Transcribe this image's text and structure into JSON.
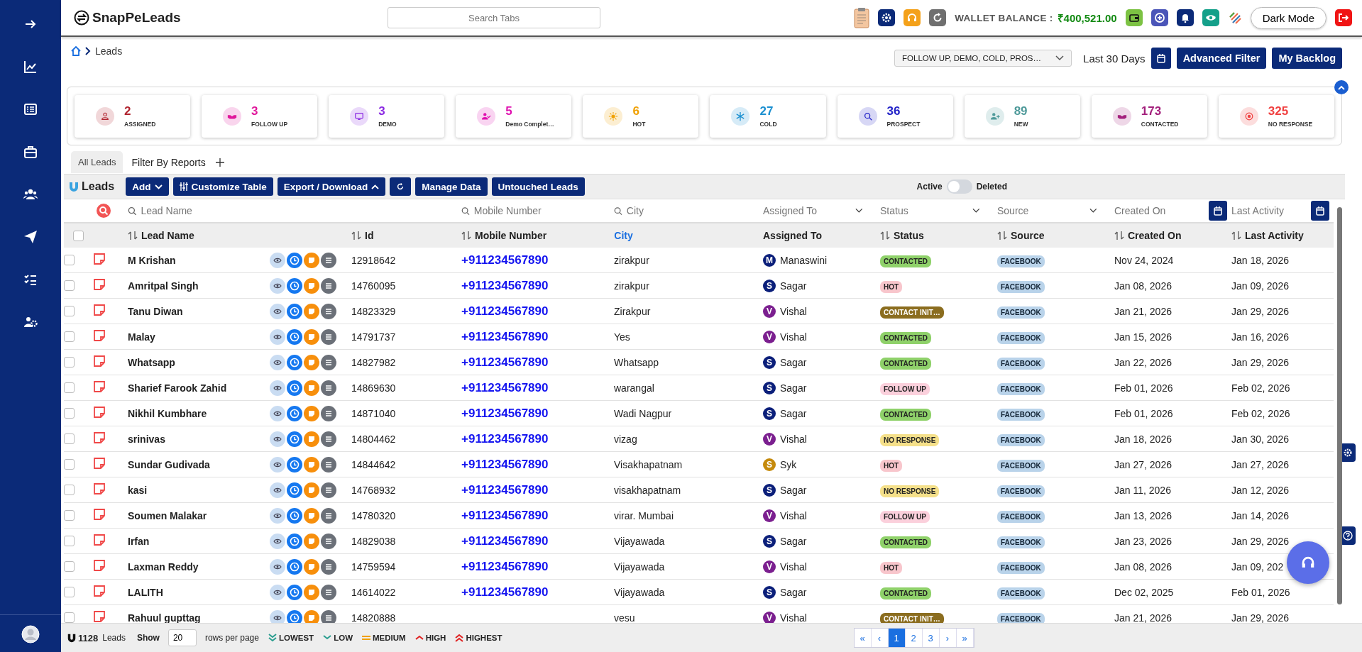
{
  "app": {
    "logo": "SnapPeLeads",
    "search": {
      "placeholder": "Search Tabs"
    },
    "wallet": {
      "label": "WALLET BALANCE :",
      "value": "₹400,521.00"
    },
    "dark_mode_button": "Dark Mode"
  },
  "breadcrumb": [
    "Leads"
  ],
  "filters": {
    "status_select": "FOLLOW UP, DEMO, COLD, PROS…",
    "range": "Last 30 Days",
    "buttons": [
      "Advanced Filter",
      "My Backlog"
    ]
  },
  "stats": [
    {
      "value": "2",
      "label": "ASSIGNED",
      "color": "#b0232e"
    },
    {
      "value": "3",
      "label": "FOLLOW UP",
      "color": "#e0179b"
    },
    {
      "value": "3",
      "label": "DEMO",
      "color": "#8b2be2"
    },
    {
      "value": "5",
      "label": "Demo Complet…",
      "color": "#e010b0"
    },
    {
      "value": "6",
      "label": "HOT",
      "color": "#f0a000"
    },
    {
      "value": "27",
      "label": "COLD",
      "color": "#1a8fd0"
    },
    {
      "value": "36",
      "label": "PROSPECT",
      "color": "#2222c8"
    },
    {
      "value": "89",
      "label": "NEW",
      "color": "#4f9a9a"
    },
    {
      "value": "173",
      "label": "CONTACTED",
      "color": "#a3207c"
    },
    {
      "value": "325",
      "label": "NO RESPONSE",
      "color": "#f04040"
    }
  ],
  "tabs": [
    {
      "label": "All Leads",
      "selected": true
    },
    {
      "label": "Filter By Reports",
      "selected": false
    }
  ],
  "toolbar": {
    "title": "Leads",
    "buttons": [
      {
        "label": "Add",
        "kind": "caret-down"
      },
      {
        "label": "Customize Table",
        "kind": "sliders"
      },
      {
        "label": "Export / Download",
        "kind": "caret-up"
      },
      {
        "kind": "refresh"
      },
      {
        "label": "Manage Data",
        "kind": "plain"
      },
      {
        "label": "Untouched Leads",
        "kind": "plain"
      }
    ],
    "toggle": {
      "left": "Active",
      "right": "Deleted",
      "on": false
    }
  },
  "column_filters": [
    {
      "kind": "search",
      "placeholder": "Lead Name"
    },
    {
      "kind": "search",
      "placeholder": "Mobile Number"
    },
    {
      "kind": "search",
      "placeholder": "City"
    },
    {
      "kind": "select",
      "placeholder": "Assigned To"
    },
    {
      "kind": "select",
      "placeholder": "Status"
    },
    {
      "kind": "select",
      "placeholder": "Source"
    },
    {
      "kind": "date",
      "placeholder": "Created On"
    },
    {
      "kind": "date",
      "placeholder": "Last Activity"
    }
  ],
  "select_all": {
    "checked": false
  },
  "columns": [
    {
      "label": "Lead Name",
      "kind": "sortable"
    },
    {
      "label": "Id",
      "kind": "sortable"
    },
    {
      "label": "Mobile Number",
      "kind": "sortable"
    },
    {
      "label": "City",
      "kind": "sorted"
    },
    {
      "label": "Assigned To",
      "kind": "plain"
    },
    {
      "label": "Status",
      "kind": "sortable"
    },
    {
      "label": "Source",
      "kind": "sortable"
    },
    {
      "label": "Created On",
      "kind": "sortable"
    },
    {
      "label": "Last Activity",
      "kind": "sortable"
    }
  ],
  "rows": [
    {
      "name": "M Krishan",
      "id": "12918642",
      "mobile": "+911234567890",
      "city": "zirakpur",
      "avatar": {
        "initial": "M",
        "color": "#0b1f7a"
      },
      "assigned": "Manaswini",
      "status": {
        "label": "CONTACTED",
        "color": "#8fd16a"
      },
      "source": "FACEBOOK",
      "created": "Nov 24, 2024",
      "last": "Jan 18, 2026",
      "checked": false
    },
    {
      "name": "Amritpal Singh",
      "id": "14760095",
      "mobile": "+911234567890",
      "city": "zirakpur",
      "avatar": {
        "initial": "S",
        "color": "#0b1f7a"
      },
      "assigned": "Sagar",
      "status": {
        "label": "HOT",
        "color": "#f8c6cc"
      },
      "source": "FACEBOOK",
      "created": "Jan 08, 2026",
      "last": "Jan 09, 2026",
      "checked": false
    },
    {
      "name": "Tanu Diwan",
      "id": "14823329",
      "mobile": "+911234567890",
      "city": "Zirakpur",
      "avatar": {
        "initial": "V",
        "color": "#7b1f8f"
      },
      "assigned": "Vishal",
      "status": {
        "label": "CONTACT INIT…",
        "color": "#8b6d1f"
      },
      "source": "FACEBOOK",
      "created": "Jan 21, 2026",
      "last": "Jan 29, 2026",
      "checked": false
    },
    {
      "name": "Malay",
      "id": "14791737",
      "mobile": "+911234567890",
      "city": "Yes",
      "avatar": {
        "initial": "V",
        "color": "#7b1f8f"
      },
      "assigned": "Vishal",
      "status": {
        "label": "CONTACTED",
        "color": "#8fd16a"
      },
      "source": "FACEBOOK",
      "created": "Jan 15, 2026",
      "last": "Jan 16, 2026",
      "checked": false
    },
    {
      "name": "Whatsapp",
      "id": "14827982",
      "mobile": "+911234567890",
      "city": "Whatsapp",
      "avatar": {
        "initial": "S",
        "color": "#0b1f7a"
      },
      "assigned": "Sagar",
      "status": {
        "label": "CONTACTED",
        "color": "#8fd16a"
      },
      "source": "FACEBOOK",
      "created": "Jan 22, 2026",
      "last": "Jan 29, 2026",
      "checked": false
    },
    {
      "name": "Sharief Farook Zahid",
      "id": "14869630",
      "mobile": "+911234567890",
      "city": "warangal",
      "avatar": {
        "initial": "S",
        "color": "#0b1f7a"
      },
      "assigned": "Sagar",
      "status": {
        "label": "FOLLOW UP",
        "color": "#fbd0dc"
      },
      "source": "FACEBOOK",
      "created": "Feb 01, 2026",
      "last": "Feb 02, 2026",
      "checked": false
    },
    {
      "name": "Nikhil Kumbhare",
      "id": "14871040",
      "mobile": "+911234567890",
      "city": "Wadi Nagpur",
      "avatar": {
        "initial": "S",
        "color": "#0b1f7a"
      },
      "assigned": "Sagar",
      "status": {
        "label": "CONTACTED",
        "color": "#8fd16a"
      },
      "source": "FACEBOOK",
      "created": "Feb 01, 2026",
      "last": "Feb 02, 2026",
      "checked": false
    },
    {
      "name": "srinivas",
      "id": "14804462",
      "mobile": "+911234567890",
      "city": "vizag",
      "avatar": {
        "initial": "V",
        "color": "#7b1f8f"
      },
      "assigned": "Vishal",
      "status": {
        "label": "NO RESPONSE",
        "color": "#f5e08a"
      },
      "source": "FACEBOOK",
      "created": "Jan 18, 2026",
      "last": "Jan 30, 2026",
      "checked": false
    },
    {
      "name": "Sundar Gudivada",
      "id": "14844642",
      "mobile": "+911234567890",
      "city": "Visakhapatnam",
      "avatar": {
        "initial": "S",
        "color": "#c58a0b"
      },
      "assigned": "Syk",
      "status": {
        "label": "HOT",
        "color": "#f8c6cc"
      },
      "source": "FACEBOOK",
      "created": "Jan 27, 2026",
      "last": "Jan 27, 2026",
      "checked": false
    },
    {
      "name": "kasi",
      "id": "14768932",
      "mobile": "+911234567890",
      "city": "visakhapatnam",
      "avatar": {
        "initial": "S",
        "color": "#0b1f7a"
      },
      "assigned": "Sagar",
      "status": {
        "label": "NO RESPONSE",
        "color": "#f5e08a"
      },
      "source": "FACEBOOK",
      "created": "Jan 11, 2026",
      "last": "Jan 12, 2026",
      "checked": false
    },
    {
      "name": "Soumen Malakar",
      "id": "14780320",
      "mobile": "+911234567890",
      "city": "virar. Mumbai",
      "avatar": {
        "initial": "V",
        "color": "#7b1f8f"
      },
      "assigned": "Vishal",
      "status": {
        "label": "FOLLOW UP",
        "color": "#fbd0dc"
      },
      "source": "FACEBOOK",
      "created": "Jan 13, 2026",
      "last": "Jan 14, 2026",
      "checked": false
    },
    {
      "name": "Irfan",
      "id": "14829038",
      "mobile": "+911234567890",
      "city": "Vijayawada",
      "avatar": {
        "initial": "S",
        "color": "#0b1f7a"
      },
      "assigned": "Sagar",
      "status": {
        "label": "CONTACTED",
        "color": "#8fd16a"
      },
      "source": "FACEBOOK",
      "created": "Jan 23, 2026",
      "last": "Jan 29, 2026",
      "checked": false
    },
    {
      "name": "Laxman Reddy",
      "id": "14759594",
      "mobile": "+911234567890",
      "city": "Vijayawada",
      "avatar": {
        "initial": "V",
        "color": "#7b1f8f"
      },
      "assigned": "Vishal",
      "status": {
        "label": "HOT",
        "color": "#f8c6cc"
      },
      "source": "FACEBOOK",
      "created": "Jan 08, 2026",
      "last": "Jan 09, 202",
      "checked": false
    },
    {
      "name": "LALITH",
      "id": "14614022",
      "mobile": "+911234567890",
      "city": "Vijayawada",
      "avatar": {
        "initial": "S",
        "color": "#0b1f7a"
      },
      "assigned": "Sagar",
      "status": {
        "label": "CONTACTED",
        "color": "#8fd16a"
      },
      "source": "FACEBOOK",
      "created": "Dec 02, 2025",
      "last": "Feb 01, 2026",
      "checked": false
    },
    {
      "name": "Rahuul gupttag",
      "id": "14820888",
      "city": "vesu",
      "avatar": {
        "initial": "V",
        "color": "#7b1f8f"
      },
      "assigned": "Vishal",
      "status": {
        "label": "CONTACT INIT…",
        "color": "#8b6d1f"
      },
      "source": "FACEBOOK",
      "created": "Jan 21, 2026",
      "last": "Jan 29, 2026",
      "checked": false
    }
  ],
  "footer": {
    "count": "1128",
    "count_label": "Leads",
    "show": "Show",
    "rows_per_page": "20",
    "rows_label": "rows per page",
    "priorities": [
      {
        "label": "LOWEST",
        "kind": "down2",
        "color": "#2a9d8f"
      },
      {
        "label": "LOW",
        "kind": "down",
        "color": "#2a9d8f"
      },
      {
        "label": "MEDIUM",
        "kind": "equal",
        "color": "#f0a000"
      },
      {
        "label": "HIGH",
        "kind": "up",
        "color": "#e02020"
      },
      {
        "label": "HIGHEST",
        "kind": "up2",
        "color": "#e02020"
      }
    ],
    "pages": [
      {
        "label": "«",
        "selected": false
      },
      {
        "label": "‹",
        "selected": false
      },
      {
        "label": "1",
        "selected": true
      },
      {
        "label": "2",
        "selected": false
      },
      {
        "label": "3",
        "selected": false
      },
      {
        "label": "›",
        "selected": false
      },
      {
        "label": "»",
        "selected": false
      }
    ]
  }
}
